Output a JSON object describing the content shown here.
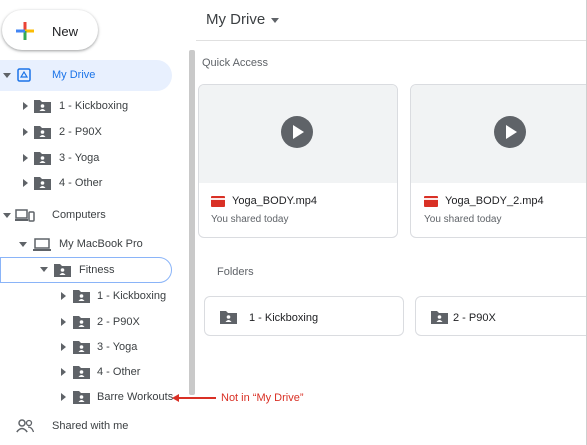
{
  "new_button": {
    "label": "New"
  },
  "sidebar": {
    "my_drive": "My Drive",
    "my_drive_items": [
      "1 - Kickboxing",
      "2 - P90X",
      "3 - Yoga",
      "4 - Other"
    ],
    "computers": "Computers",
    "macbook": "My MacBook Pro",
    "fitness": "Fitness",
    "fitness_items": [
      "1 - Kickboxing",
      "2 - P90X",
      "3 - Yoga",
      "4 - Other",
      "Barre Workouts"
    ],
    "shared": "Shared with me"
  },
  "header": {
    "title": "My Drive"
  },
  "quick_access": {
    "label": "Quick Access",
    "files": [
      {
        "name": "Yoga_BODY.mp4",
        "sub": "You shared today"
      },
      {
        "name": "Yoga_BODY_2.mp4",
        "sub": "You shared today"
      }
    ]
  },
  "folders": {
    "label": "Folders",
    "items": [
      "1 - Kickboxing",
      "2 - P90X"
    ]
  },
  "annotation": {
    "text": "Not in “My Drive”"
  },
  "colors": {
    "accent": "#1a73e8",
    "selected_bg": "#e8f0fe",
    "annotation": "#d93025"
  }
}
